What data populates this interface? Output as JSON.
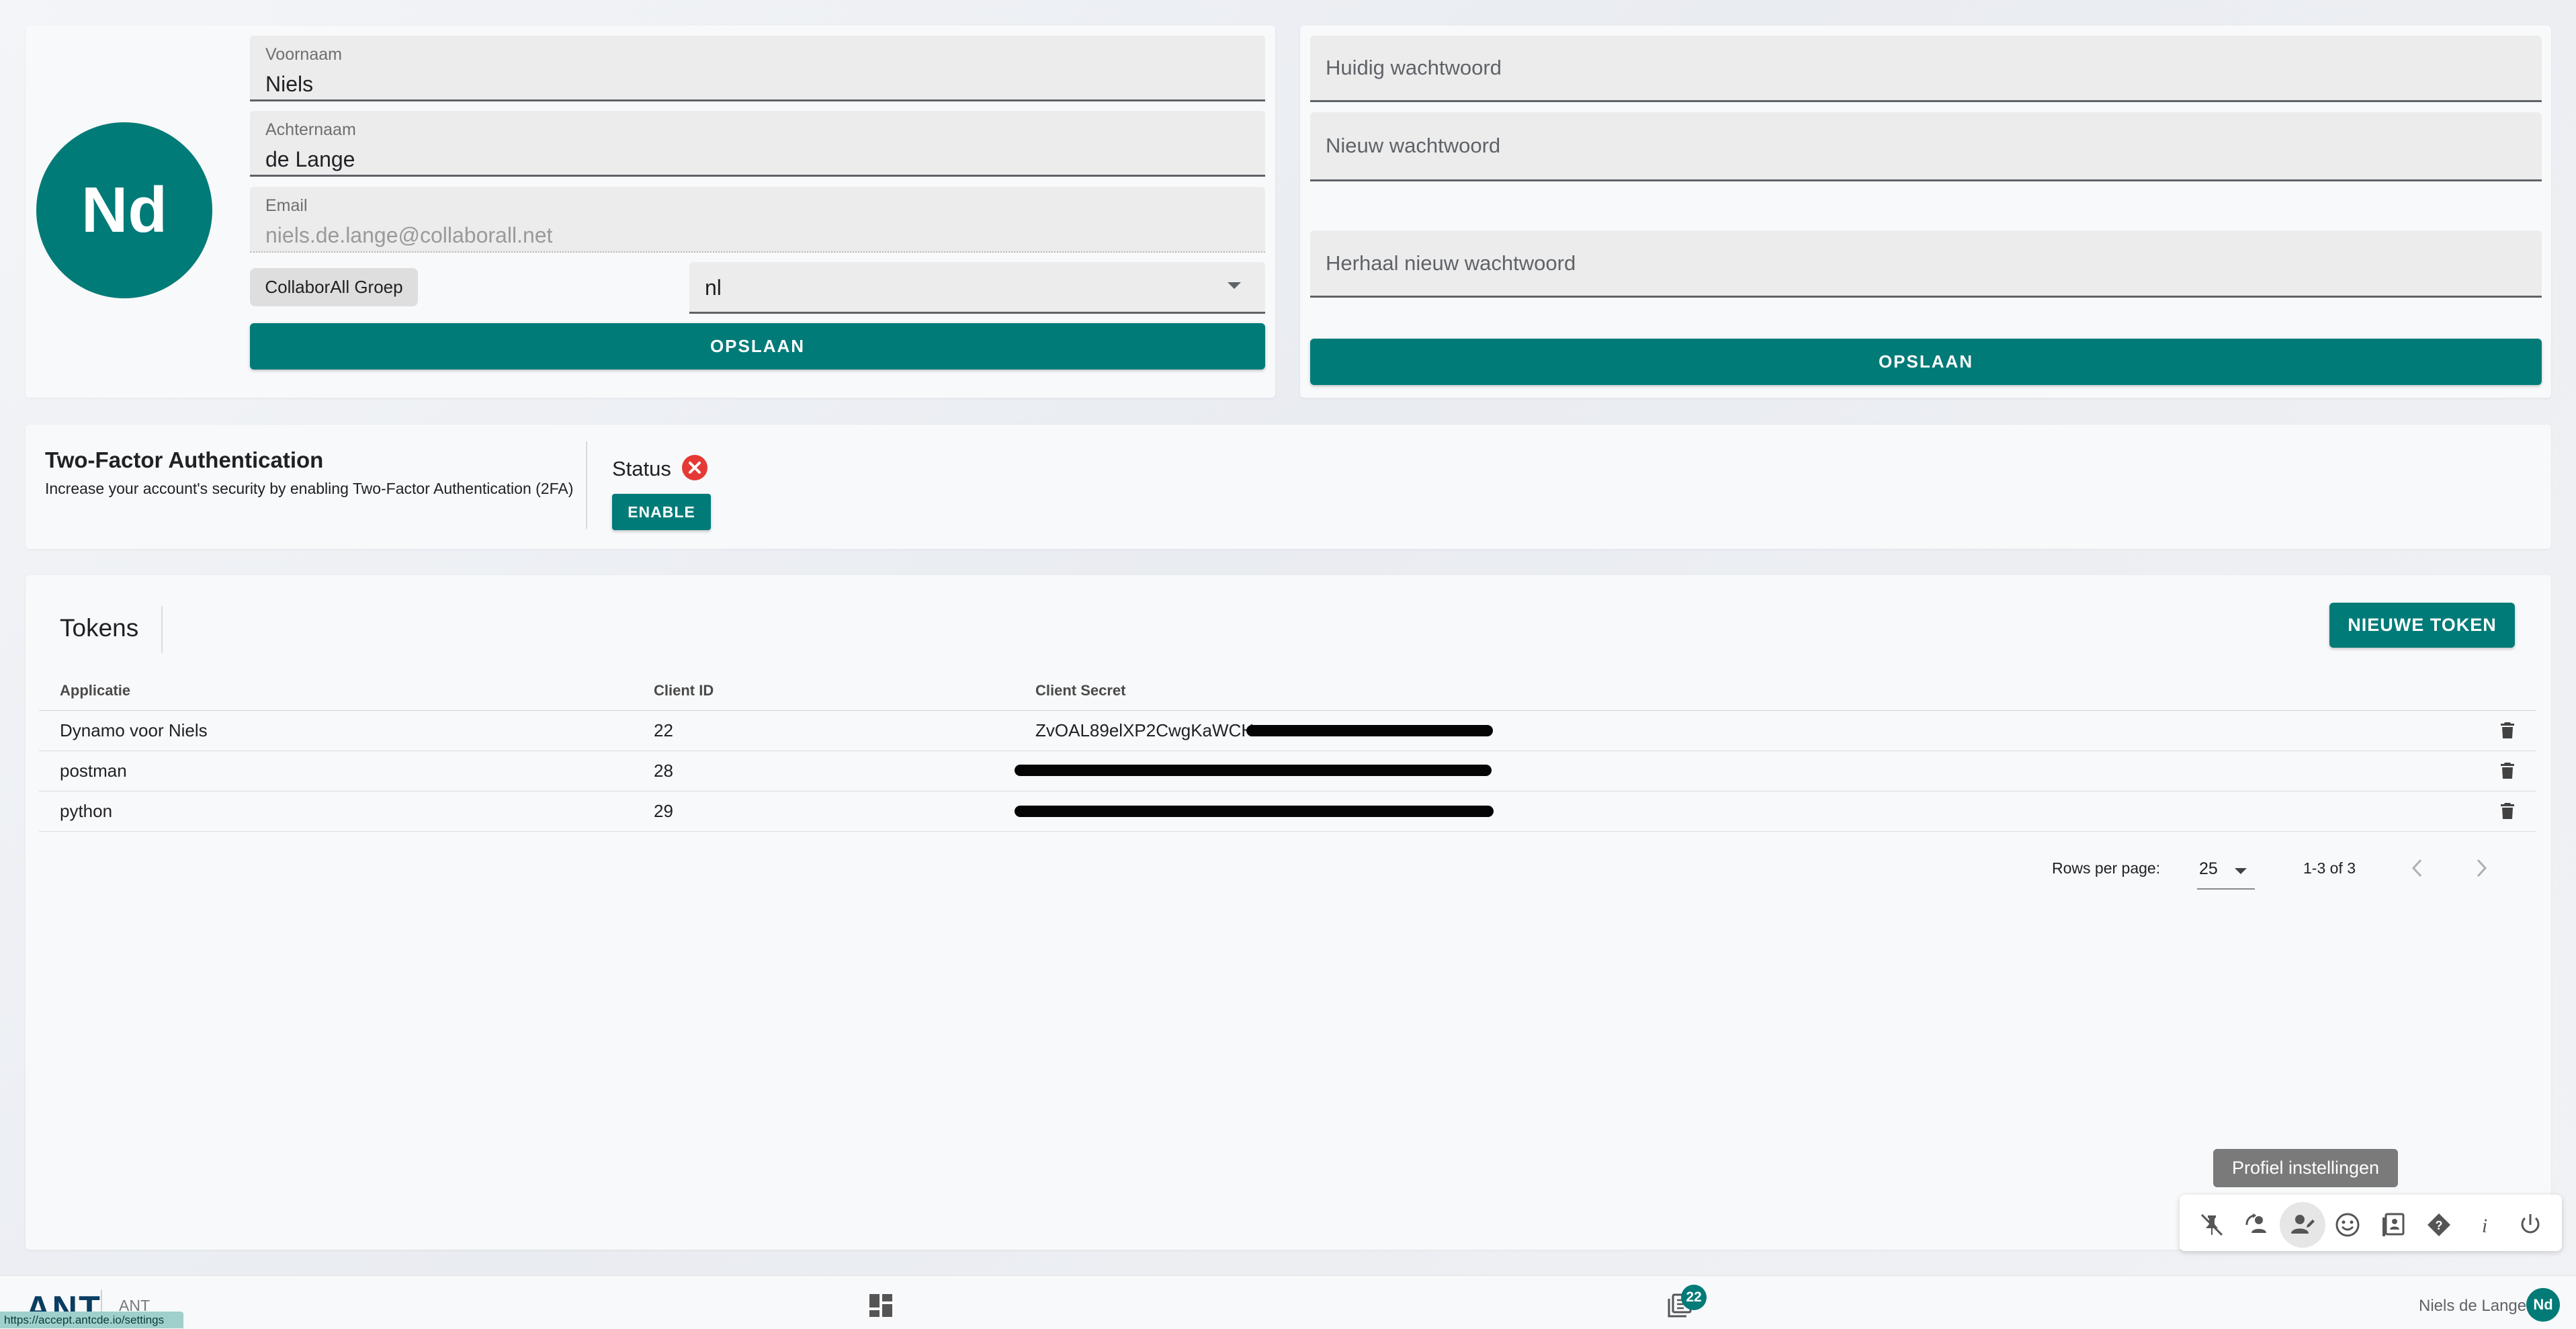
{
  "profile": {
    "avatar_initials": "Nd",
    "first_name": {
      "label": "Voornaam",
      "value": "Niels"
    },
    "last_name": {
      "label": "Achternaam",
      "value": "de Lange"
    },
    "email": {
      "label": "Email",
      "value": "niels.de.lange@collaborall.net"
    },
    "group_chip": "CollaborAll Groep",
    "language": {
      "value": "nl"
    },
    "save_label": "OPSLAAN"
  },
  "password": {
    "current_placeholder": "Huidig wachtwoord",
    "new_placeholder": "Nieuw wachtwoord",
    "repeat_placeholder": "Herhaal nieuw wachtwoord",
    "save_label": "OPSLAAN"
  },
  "two_factor": {
    "title": "Two-Factor Authentication",
    "description": "Increase your account's security by enabling Two-Factor Authentication (2FA)",
    "status_label": "Status",
    "status_icon": "close-circle-icon",
    "status_color": "#e53935",
    "enable_label": "ENABLE"
  },
  "tokens": {
    "title": "Tokens",
    "new_token_label": "NIEUWE TOKEN",
    "columns": [
      "Applicatie",
      "Client ID",
      "Client Secret"
    ],
    "rows": [
      {
        "app": "Dynamo voor Niels",
        "client_id": "22",
        "secret_visible": "ZvOAL89elXP2CwgKaWCH"
      },
      {
        "app": "postman",
        "client_id": "28",
        "secret_visible": ""
      },
      {
        "app": "python",
        "client_id": "29",
        "secret_visible": ""
      }
    ],
    "pagination": {
      "rows_per_page_label": "Rows per page:",
      "rows_per_page_value": "25",
      "range": "1-3 of 3"
    }
  },
  "tooltip": "Profiel instellingen",
  "dock_icons": [
    "pin-off-icon",
    "account-refresh-icon",
    "account-edit-icon",
    "emoticon-icon",
    "book-account-icon",
    "help-diamond-icon",
    "info-icon",
    "power-icon"
  ],
  "bottom_bar": {
    "logo_text": "ANT",
    "app_name": "ANT",
    "notification_count": "22",
    "user_name": "Niels de Lange",
    "user_initials": "Nd"
  },
  "status_url": "https://accept.antcde.io/settings",
  "colors": {
    "primary": "#007b78",
    "error": "#e53935"
  }
}
